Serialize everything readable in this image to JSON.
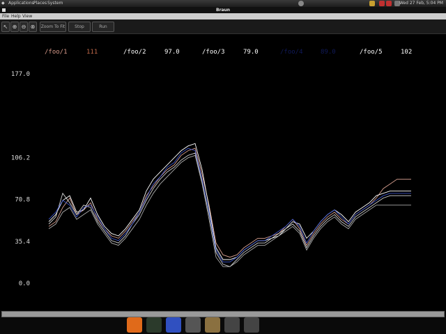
{
  "panel": {
    "menus": [
      "Applications",
      "Places",
      "System"
    ],
    "clock": "Wed 27 Feb, 5:04 PM"
  },
  "window": {
    "title": "Braun"
  },
  "menubar": {
    "items": [
      "File",
      "Help",
      "View"
    ]
  },
  "toolbar": {
    "tools": [
      {
        "name": "pointer-tool",
        "glyph": "↖"
      },
      {
        "name": "zoom-in-tool",
        "glyph": "⊕"
      },
      {
        "name": "zoom-out-tool",
        "glyph": "⊖"
      },
      {
        "name": "zoom-reset-tool",
        "glyph": "⊗"
      }
    ],
    "zoom_to_fit": "Zoom To Fit",
    "stop": "Stop",
    "run": "Run"
  },
  "legend": [
    {
      "name": "/foo/1",
      "value": "111",
      "name_color": "#d89a8a",
      "value_color": "#c26a4a"
    },
    {
      "name": "/foo/2",
      "value": "97.0",
      "name_color": "#ffffff",
      "value_color": "#ffffff"
    },
    {
      "name": "/foo/3",
      "value": "79.0",
      "name_color": "#ffffff",
      "value_color": "#ffffff"
    },
    {
      "name": "/foo/4",
      "value": "89.0",
      "name_color": "#101a5a",
      "value_color": "#101a5a"
    },
    {
      "name": "/foo/5",
      "value": "102",
      "name_color": "#ffffff",
      "value_color": "#ffffff"
    }
  ],
  "chart_data": {
    "type": "line",
    "ylim": [
      0,
      177
    ],
    "yticks": [
      "177.0",
      "106.2",
      "70.8",
      "35.4",
      "0.0"
    ],
    "ytick_values": [
      177.0,
      106.2,
      70.8,
      35.4,
      0.0
    ],
    "x": [
      0,
      1,
      2,
      3,
      4,
      5,
      6,
      7,
      8,
      9,
      10,
      11,
      12,
      13,
      14,
      15,
      16,
      17,
      18,
      19,
      20,
      21,
      22,
      23,
      24,
      25,
      26,
      27,
      28,
      29,
      30,
      31,
      32,
      33,
      34,
      35,
      36,
      37,
      38,
      39,
      40,
      41,
      42,
      43,
      44,
      45,
      46,
      47,
      48,
      49,
      50,
      51,
      52
    ],
    "series": [
      {
        "color": "#d8a090",
        "values": [
          48,
          52,
          64,
          72,
          58,
          62,
          68,
          54,
          46,
          40,
          38,
          44,
          52,
          60,
          74,
          82,
          90,
          96,
          100,
          108,
          112,
          114,
          92,
          66,
          34,
          24,
          22,
          24,
          30,
          34,
          38,
          38,
          40,
          42,
          48,
          54,
          46,
          32,
          42,
          50,
          56,
          60,
          54,
          50,
          58,
          62,
          66,
          72,
          80,
          84,
          88,
          88,
          88
        ]
      },
      {
        "color": "#ffffff",
        "values": [
          52,
          58,
          70,
          74,
          60,
          62,
          72,
          58,
          48,
          42,
          40,
          46,
          54,
          62,
          78,
          88,
          94,
          100,
          106,
          112,
          116,
          118,
          96,
          64,
          30,
          20,
          20,
          22,
          28,
          32,
          36,
          36,
          38,
          40,
          46,
          52,
          50,
          38,
          44,
          52,
          58,
          62,
          58,
          52,
          60,
          64,
          68,
          74,
          76,
          78,
          78,
          78,
          78
        ]
      },
      {
        "color": "#cfcfcf",
        "values": [
          50,
          56,
          76,
          68,
          58,
          66,
          64,
          52,
          44,
          36,
          34,
          40,
          50,
          58,
          70,
          80,
          88,
          94,
          98,
          104,
          108,
          110,
          86,
          58,
          26,
          16,
          14,
          20,
          26,
          30,
          34,
          34,
          38,
          42,
          46,
          50,
          44,
          30,
          40,
          48,
          54,
          58,
          52,
          48,
          56,
          60,
          64,
          68,
          72,
          74,
          74,
          74,
          74
        ]
      },
      {
        "color": "#3c55c8",
        "values": [
          54,
          60,
          70,
          66,
          56,
          64,
          66,
          56,
          46,
          38,
          36,
          42,
          50,
          60,
          72,
          84,
          90,
          98,
          102,
          110,
          114,
          112,
          88,
          60,
          28,
          18,
          18,
          22,
          28,
          32,
          36,
          36,
          40,
          44,
          48,
          54,
          48,
          34,
          44,
          52,
          58,
          62,
          56,
          50,
          58,
          62,
          66,
          70,
          74,
          76,
          76,
          76,
          76
        ]
      },
      {
        "color": "#aaaaaa",
        "values": [
          46,
          50,
          60,
          64,
          54,
          58,
          62,
          50,
          42,
          34,
          32,
          38,
          46,
          54,
          66,
          76,
          84,
          90,
          96,
          102,
          106,
          108,
          84,
          54,
          22,
          14,
          14,
          18,
          24,
          28,
          32,
          32,
          36,
          40,
          44,
          48,
          42,
          28,
          38,
          46,
          52,
          56,
          50,
          46,
          54,
          58,
          62,
          66,
          66,
          66,
          66,
          66,
          66
        ]
      }
    ]
  },
  "dock": [
    {
      "name": "firefox-icon",
      "color": "#e06a1a"
    },
    {
      "name": "terminal-icon",
      "color": "#2b3a2b"
    },
    {
      "name": "network-icon",
      "color": "#3050c0"
    },
    {
      "name": "settings-icon",
      "color": "#555555"
    },
    {
      "name": "media-icon",
      "color": "#8a7040"
    },
    {
      "name": "window-icon",
      "color": "#444444"
    },
    {
      "name": "window-icon-2",
      "color": "#444444"
    }
  ]
}
